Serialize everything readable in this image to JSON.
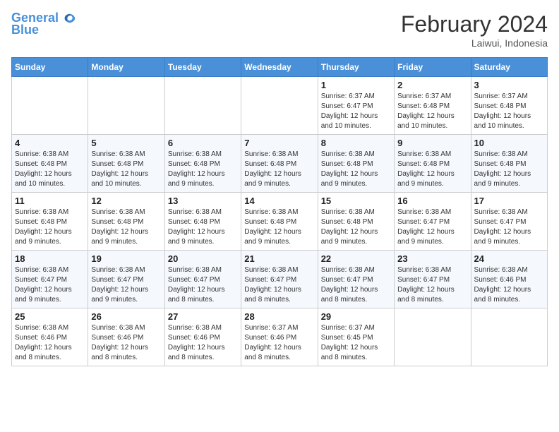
{
  "header": {
    "logo_line1": "General",
    "logo_line2": "Blue",
    "month_title": "February 2024",
    "location": "Laiwui, Indonesia"
  },
  "days_of_week": [
    "Sunday",
    "Monday",
    "Tuesday",
    "Wednesday",
    "Thursday",
    "Friday",
    "Saturday"
  ],
  "weeks": [
    [
      {
        "day": "",
        "info": ""
      },
      {
        "day": "",
        "info": ""
      },
      {
        "day": "",
        "info": ""
      },
      {
        "day": "",
        "info": ""
      },
      {
        "day": "1",
        "info": "Sunrise: 6:37 AM\nSunset: 6:47 PM\nDaylight: 12 hours and 10 minutes."
      },
      {
        "day": "2",
        "info": "Sunrise: 6:37 AM\nSunset: 6:48 PM\nDaylight: 12 hours and 10 minutes."
      },
      {
        "day": "3",
        "info": "Sunrise: 6:37 AM\nSunset: 6:48 PM\nDaylight: 12 hours and 10 minutes."
      }
    ],
    [
      {
        "day": "4",
        "info": "Sunrise: 6:38 AM\nSunset: 6:48 PM\nDaylight: 12 hours and 10 minutes."
      },
      {
        "day": "5",
        "info": "Sunrise: 6:38 AM\nSunset: 6:48 PM\nDaylight: 12 hours and 10 minutes."
      },
      {
        "day": "6",
        "info": "Sunrise: 6:38 AM\nSunset: 6:48 PM\nDaylight: 12 hours and 9 minutes."
      },
      {
        "day": "7",
        "info": "Sunrise: 6:38 AM\nSunset: 6:48 PM\nDaylight: 12 hours and 9 minutes."
      },
      {
        "day": "8",
        "info": "Sunrise: 6:38 AM\nSunset: 6:48 PM\nDaylight: 12 hours and 9 minutes."
      },
      {
        "day": "9",
        "info": "Sunrise: 6:38 AM\nSunset: 6:48 PM\nDaylight: 12 hours and 9 minutes."
      },
      {
        "day": "10",
        "info": "Sunrise: 6:38 AM\nSunset: 6:48 PM\nDaylight: 12 hours and 9 minutes."
      }
    ],
    [
      {
        "day": "11",
        "info": "Sunrise: 6:38 AM\nSunset: 6:48 PM\nDaylight: 12 hours and 9 minutes."
      },
      {
        "day": "12",
        "info": "Sunrise: 6:38 AM\nSunset: 6:48 PM\nDaylight: 12 hours and 9 minutes."
      },
      {
        "day": "13",
        "info": "Sunrise: 6:38 AM\nSunset: 6:48 PM\nDaylight: 12 hours and 9 minutes."
      },
      {
        "day": "14",
        "info": "Sunrise: 6:38 AM\nSunset: 6:48 PM\nDaylight: 12 hours and 9 minutes."
      },
      {
        "day": "15",
        "info": "Sunrise: 6:38 AM\nSunset: 6:48 PM\nDaylight: 12 hours and 9 minutes."
      },
      {
        "day": "16",
        "info": "Sunrise: 6:38 AM\nSunset: 6:47 PM\nDaylight: 12 hours and 9 minutes."
      },
      {
        "day": "17",
        "info": "Sunrise: 6:38 AM\nSunset: 6:47 PM\nDaylight: 12 hours and 9 minutes."
      }
    ],
    [
      {
        "day": "18",
        "info": "Sunrise: 6:38 AM\nSunset: 6:47 PM\nDaylight: 12 hours and 9 minutes."
      },
      {
        "day": "19",
        "info": "Sunrise: 6:38 AM\nSunset: 6:47 PM\nDaylight: 12 hours and 9 minutes."
      },
      {
        "day": "20",
        "info": "Sunrise: 6:38 AM\nSunset: 6:47 PM\nDaylight: 12 hours and 8 minutes."
      },
      {
        "day": "21",
        "info": "Sunrise: 6:38 AM\nSunset: 6:47 PM\nDaylight: 12 hours and 8 minutes."
      },
      {
        "day": "22",
        "info": "Sunrise: 6:38 AM\nSunset: 6:47 PM\nDaylight: 12 hours and 8 minutes."
      },
      {
        "day": "23",
        "info": "Sunrise: 6:38 AM\nSunset: 6:47 PM\nDaylight: 12 hours and 8 minutes."
      },
      {
        "day": "24",
        "info": "Sunrise: 6:38 AM\nSunset: 6:46 PM\nDaylight: 12 hours and 8 minutes."
      }
    ],
    [
      {
        "day": "25",
        "info": "Sunrise: 6:38 AM\nSunset: 6:46 PM\nDaylight: 12 hours and 8 minutes."
      },
      {
        "day": "26",
        "info": "Sunrise: 6:38 AM\nSunset: 6:46 PM\nDaylight: 12 hours and 8 minutes."
      },
      {
        "day": "27",
        "info": "Sunrise: 6:38 AM\nSunset: 6:46 PM\nDaylight: 12 hours and 8 minutes."
      },
      {
        "day": "28",
        "info": "Sunrise: 6:37 AM\nSunset: 6:46 PM\nDaylight: 12 hours and 8 minutes."
      },
      {
        "day": "29",
        "info": "Sunrise: 6:37 AM\nSunset: 6:45 PM\nDaylight: 12 hours and 8 minutes."
      },
      {
        "day": "",
        "info": ""
      },
      {
        "day": "",
        "info": ""
      }
    ]
  ]
}
